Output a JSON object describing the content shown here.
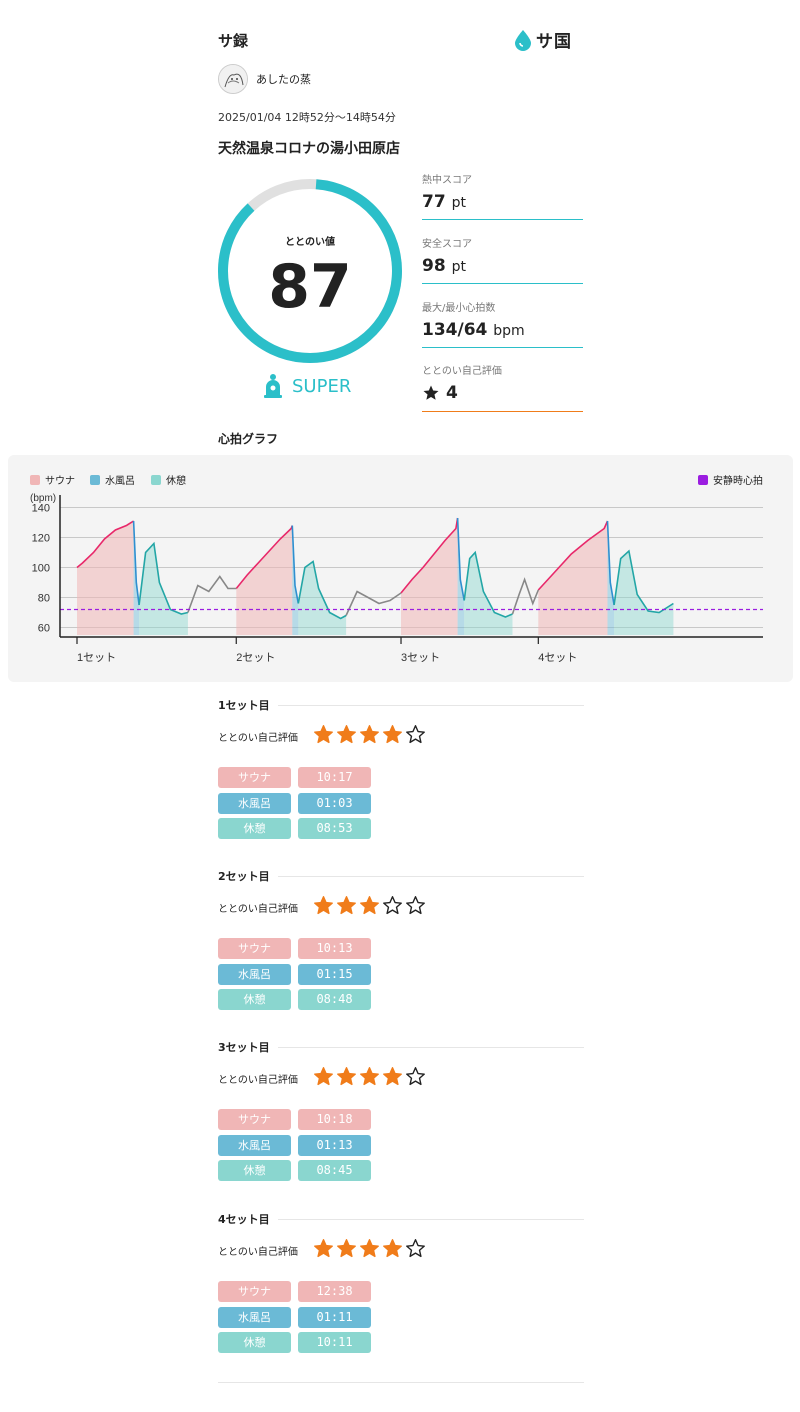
{
  "header": {
    "title": "サ録",
    "logo_text": "サ国"
  },
  "user": {
    "name": "あしたの蒸"
  },
  "datetime": "2025/01/04 12時52分〜14時54分",
  "facility": "天然温泉コロナの湯小田原店",
  "totonoi": {
    "label": "ととのい値",
    "value": "87",
    "fraction": 0.87,
    "rank": "SUPER"
  },
  "stats": [
    {
      "label": "熱中スコア",
      "value": "77",
      "unit": "pt"
    },
    {
      "label": "安全スコア",
      "value": "98",
      "unit": "pt"
    },
    {
      "label": "最大/最小心拍数",
      "value": "134/64",
      "unit": "bpm"
    },
    {
      "label": "ととのい自己評価",
      "value": "4",
      "unit": ""
    }
  ],
  "graph_section_title": "心拍グラフ",
  "colors": {
    "accent": "#2bbfc9",
    "sauna": "#f0b6b6",
    "water": "#6bbad6",
    "rest": "#8ad6cf",
    "resting_line": "#9b1de0",
    "star": "#f07c1a",
    "rating_underline": "#f07c1a"
  },
  "chart_data": {
    "type": "line",
    "ylabel": "(bpm)",
    "ylim": [
      55,
      145
    ],
    "yticks": [
      "140",
      "120",
      "100",
      "80",
      "60"
    ],
    "x_tick_labels": [
      "1セット",
      "2セット",
      "3セット",
      "4セット"
    ],
    "legend": [
      {
        "name": "サウナ",
        "color": "#f0b6b6"
      },
      {
        "name": "水風呂",
        "color": "#6bbad6"
      },
      {
        "name": "休憩",
        "color": "#8ad6cf"
      },
      {
        "name": "安静時心拍",
        "color": "#9b1de0"
      }
    ],
    "resting_hr": 72,
    "x_range_min": [
      0,
      122
    ],
    "set_starts_min": [
      0,
      29,
      59,
      84
    ],
    "series": [
      {
        "name": "サウナ",
        "segments": [
          {
            "x": [
              0,
              1,
              3,
              5,
              7,
              9,
              10.3
            ],
            "y": [
              100,
              103,
              110,
              119,
              125,
              128,
              131
            ]
          },
          {
            "x": [
              29,
              31,
              33,
              35,
              37,
              39,
              39.2
            ],
            "y": [
              86,
              95,
              103,
              111,
              119,
              126,
              128
            ]
          },
          {
            "x": [
              59,
              61,
              63,
              65,
              67,
              69,
              69.3
            ],
            "y": [
              83,
              92,
              100,
              109,
              118,
              126,
              133
            ]
          },
          {
            "x": [
              84,
              87,
              90,
              93,
              96,
              96.6
            ],
            "y": [
              85,
              97,
              109,
              118,
              126,
              131
            ]
          }
        ]
      },
      {
        "name": "水風呂",
        "segments": [
          {
            "x": [
              10.3,
              10.8,
              11.3
            ],
            "y": [
              131,
              90,
              75
            ]
          },
          {
            "x": [
              39.2,
              39.7,
              40.3
            ],
            "y": [
              128,
              88,
              76
            ]
          },
          {
            "x": [
              69.3,
              69.8,
              70.5
            ],
            "y": [
              133,
              92,
              78
            ]
          },
          {
            "x": [
              96.6,
              97.1,
              97.8
            ],
            "y": [
              131,
              90,
              75
            ]
          }
        ]
      },
      {
        "name": "休憩",
        "segments": [
          {
            "x": [
              11.3,
              12.5,
              14,
              15,
              17,
              19,
              20.2
            ],
            "y": [
              75,
              110,
              116,
              90,
              72,
              69,
              70
            ]
          },
          {
            "x": [
              40.3,
              41.5,
              43,
              44,
              46,
              48,
              49
            ],
            "y": [
              76,
              100,
              104,
              86,
              70,
              66,
              68
            ]
          },
          {
            "x": [
              70.5,
              71.5,
              72.5,
              74,
              76,
              78,
              79.3
            ],
            "y": [
              78,
              106,
              110,
              84,
              70,
              67,
              69
            ]
          },
          {
            "x": [
              97.8,
              99,
              100.5,
              102,
              104,
              106,
              108.6
            ],
            "y": [
              75,
              106,
              111,
              82,
              71,
              70,
              76
            ]
          }
        ]
      },
      {
        "name": "other",
        "segments": [
          {
            "x": [
              20.2,
              22,
              24,
              26,
              27.5,
              29
            ],
            "y": [
              70,
              88,
              84,
              94,
              86,
              86
            ]
          },
          {
            "x": [
              49,
              51,
              53,
              55,
              57,
              59
            ],
            "y": [
              68,
              84,
              80,
              76,
              78,
              83
            ]
          },
          {
            "x": [
              79.3,
              80.5,
              81.5,
              83,
              84
            ],
            "y": [
              69,
              82,
              92,
              76,
              85
            ]
          }
        ]
      }
    ]
  },
  "sets": [
    {
      "title": "1セット目",
      "rating_label": "ととのい自己評価",
      "rating": 4,
      "max_rating": 5,
      "items": [
        {
          "label": "サウナ",
          "time": "10:17"
        },
        {
          "label": "水風呂",
          "time": "01:03"
        },
        {
          "label": "休憩",
          "time": "08:53"
        }
      ]
    },
    {
      "title": "2セット目",
      "rating_label": "ととのい自己評価",
      "rating": 3,
      "max_rating": 5,
      "items": [
        {
          "label": "サウナ",
          "time": "10:13"
        },
        {
          "label": "水風呂",
          "time": "01:15"
        },
        {
          "label": "休憩",
          "time": "08:48"
        }
      ]
    },
    {
      "title": "3セット目",
      "rating_label": "ととのい自己評価",
      "rating": 4,
      "max_rating": 5,
      "items": [
        {
          "label": "サウナ",
          "time": "10:18"
        },
        {
          "label": "水風呂",
          "time": "01:13"
        },
        {
          "label": "休憩",
          "time": "08:45"
        }
      ]
    },
    {
      "title": "4セット目",
      "rating_label": "ととのい自己評価",
      "rating": 4,
      "max_rating": 5,
      "items": [
        {
          "label": "サウナ",
          "time": "12:38"
        },
        {
          "label": "水風呂",
          "time": "01:11"
        },
        {
          "label": "休憩",
          "time": "10:11"
        }
      ]
    }
  ]
}
